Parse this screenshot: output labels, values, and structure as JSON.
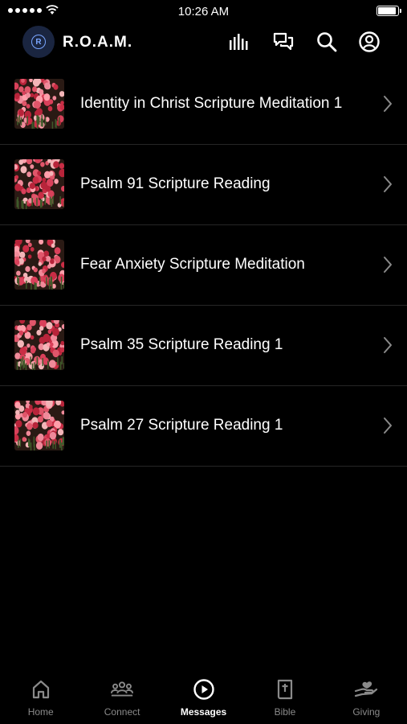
{
  "status_bar": {
    "time": "10:26 AM"
  },
  "header": {
    "app_name": "R.O.A.M.",
    "logo_letter": "R"
  },
  "items": [
    {
      "title": "Identity in Christ Scripture Meditation 1"
    },
    {
      "title": "Psalm 91 Scripture Reading"
    },
    {
      "title": "Fear Anxiety Scripture Meditation"
    },
    {
      "title": "Psalm 35 Scripture Reading 1"
    },
    {
      "title": "Psalm 27 Scripture Reading 1"
    }
  ],
  "tabs": [
    {
      "label": "Home",
      "icon": "home-icon"
    },
    {
      "label": "Connect",
      "icon": "people-icon"
    },
    {
      "label": "Messages",
      "icon": "play-circle-icon",
      "active": true
    },
    {
      "label": "Bible",
      "icon": "bible-icon"
    },
    {
      "label": "Giving",
      "icon": "hand-heart-icon"
    }
  ],
  "colors": {
    "background": "#000000",
    "inactive_tab": "#8a8a8a",
    "active_tab": "#ffffff"
  }
}
